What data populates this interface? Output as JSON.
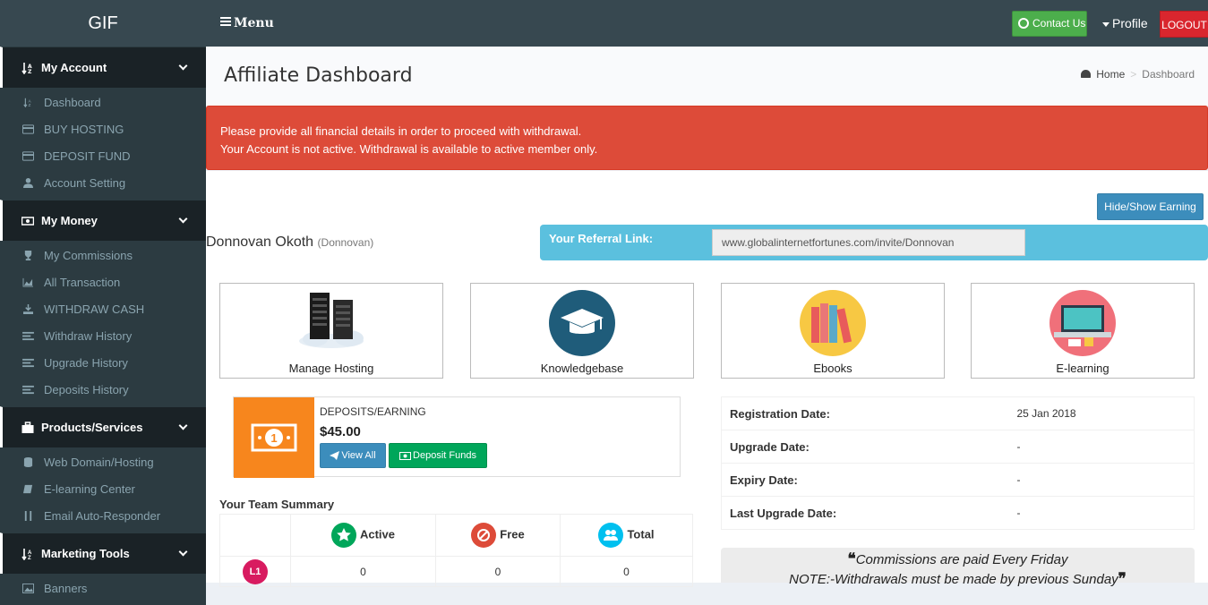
{
  "app": {
    "logo": "GIF",
    "menu_label": "Menu",
    "contact_label": "Contact Us",
    "profile_label": "Profile",
    "logout_label": "LOGOUT"
  },
  "sidebar": {
    "sections": [
      {
        "label": "My Account",
        "icon": "sort-alpha-icon",
        "items": [
          {
            "label": "Dashboard",
            "icon": "sort-alpha-icon"
          },
          {
            "label": "BUY HOSTING",
            "icon": "credit-card-icon"
          },
          {
            "label": "DEPOSIT FUND",
            "icon": "credit-card-icon"
          },
          {
            "label": "Account Setting",
            "icon": "user-icon"
          }
        ]
      },
      {
        "label": "My Money",
        "icon": "money-icon",
        "items": [
          {
            "label": "My Commissions",
            "icon": "trophy-icon"
          },
          {
            "label": "All Transaction",
            "icon": "area-chart-icon"
          },
          {
            "label": "WITHDRAW CASH",
            "icon": "download-icon"
          },
          {
            "label": "Withdraw History",
            "icon": "list-icon"
          },
          {
            "label": "Upgrade History",
            "icon": "list-icon"
          },
          {
            "label": "Deposits History",
            "icon": "list-icon"
          }
        ]
      },
      {
        "label": "Products/Services",
        "icon": "briefcase-icon",
        "items": [
          {
            "label": "Web Domain/Hosting",
            "icon": "database-icon"
          },
          {
            "label": "E-learning Center",
            "icon": "book-icon"
          },
          {
            "label": "Email Auto-Responder",
            "icon": "cutlery-icon"
          }
        ]
      },
      {
        "label": "Marketing Tools",
        "icon": "sort-alpha-icon",
        "items": [
          {
            "label": "Banners",
            "icon": "image-icon"
          }
        ]
      }
    ]
  },
  "header": {
    "title": "Affiliate Dashboard",
    "breadcrumb_home": "Home",
    "breadcrumb_current": "Dashboard"
  },
  "alert": {
    "line1": "Please provide all financial details in order to proceed with withdrawal.",
    "line2": "Your Account is not active. Withdrawal is available to active member only."
  },
  "main": {
    "hide_show_label": "Hide/Show Earning",
    "user_name": "Donnovan Okoth",
    "username": "(Donnovan)",
    "referral_label": "Your Referral Link:",
    "referral_link": "www.globalinternetfortunes.com/invite/Donnovan",
    "tiles": [
      "Manage Hosting",
      "Knowledgebase",
      "Ebooks",
      "E-learning"
    ],
    "deposits": {
      "title": "DEPOSITS/EARNING",
      "amount": "$45.00",
      "view_all": "View All",
      "deposit_funds": "Deposit Funds"
    },
    "team": {
      "title": "Your Team Summary",
      "headers": [
        "Active",
        "Free",
        "Total"
      ],
      "rows": [
        {
          "level": "L1",
          "active": "0",
          "free": "0",
          "total": "0"
        }
      ]
    },
    "info": [
      {
        "key": "Registration Date:",
        "value": "25 Jan 2018"
      },
      {
        "key": "Upgrade Date:",
        "value": "-"
      },
      {
        "key": "Expiry Date:",
        "value": "-"
      },
      {
        "key": "Last Upgrade Date:",
        "value": "-"
      }
    ],
    "notice": {
      "line1": "Commissions are paid Every Friday",
      "line2": "NOTE:-Withdrawals must be made by previous Sunday"
    }
  },
  "colors": {
    "topbar": "#374850",
    "sidebar": "#222d32",
    "alert": "#dd4b39",
    "primary": "#3c8dbc",
    "success": "#00a65a",
    "referral": "#5bc0de"
  }
}
